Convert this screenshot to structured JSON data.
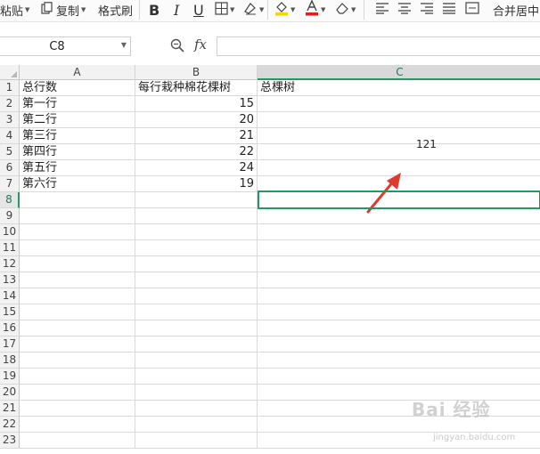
{
  "toolbar": {
    "paste": "粘贴",
    "copy": "复制",
    "format_painter": "格式刷",
    "bold": "B",
    "italic": "I",
    "underline": "U",
    "merge_center": "合并居中"
  },
  "formula_bar": {
    "name_box": "C8",
    "fx_label": "fx",
    "formula": ""
  },
  "columns": [
    "A",
    "B",
    "C"
  ],
  "rows": [
    {
      "num": "1",
      "a": "总行数",
      "b": "每行栽种棉花棵树",
      "c": "总棵树"
    },
    {
      "num": "2",
      "a": "第一行",
      "b": "15",
      "c": ""
    },
    {
      "num": "3",
      "a": "第二行",
      "b": "20",
      "c": ""
    },
    {
      "num": "4",
      "a": "第三行",
      "b": "21",
      "c": ""
    },
    {
      "num": "5",
      "a": "第四行",
      "b": "22",
      "c": ""
    },
    {
      "num": "6",
      "a": "第五行",
      "b": "24",
      "c": ""
    },
    {
      "num": "7",
      "a": "第六行",
      "b": "19",
      "c": ""
    },
    {
      "num": "8",
      "a": "",
      "b": "",
      "c": ""
    },
    {
      "num": "9",
      "a": "",
      "b": "",
      "c": ""
    },
    {
      "num": "10",
      "a": "",
      "b": "",
      "c": ""
    },
    {
      "num": "11",
      "a": "",
      "b": "",
      "c": ""
    },
    {
      "num": "12",
      "a": "",
      "b": "",
      "c": ""
    },
    {
      "num": "13",
      "a": "",
      "b": "",
      "c": ""
    },
    {
      "num": "14",
      "a": "",
      "b": "",
      "c": ""
    },
    {
      "num": "15",
      "a": "",
      "b": "",
      "c": ""
    },
    {
      "num": "16",
      "a": "",
      "b": "",
      "c": ""
    },
    {
      "num": "17",
      "a": "",
      "b": "",
      "c": ""
    },
    {
      "num": "18",
      "a": "",
      "b": "",
      "c": ""
    },
    {
      "num": "19",
      "a": "",
      "b": "",
      "c": ""
    },
    {
      "num": "20",
      "a": "",
      "b": "",
      "c": ""
    },
    {
      "num": "21",
      "a": "",
      "b": "",
      "c": ""
    },
    {
      "num": "22",
      "a": "",
      "b": "",
      "c": ""
    },
    {
      "num": "23",
      "a": "",
      "b": "",
      "c": ""
    }
  ],
  "selected_row": "8",
  "annotation_value": "121",
  "watermark": "Bai 经验",
  "watermark_url": "jingyan.baidu.com",
  "colors": {
    "accent": "#1f9b62",
    "arrow": "#e03a2f",
    "highlight_yellow": "#f5d400",
    "font_red": "#e02020"
  }
}
